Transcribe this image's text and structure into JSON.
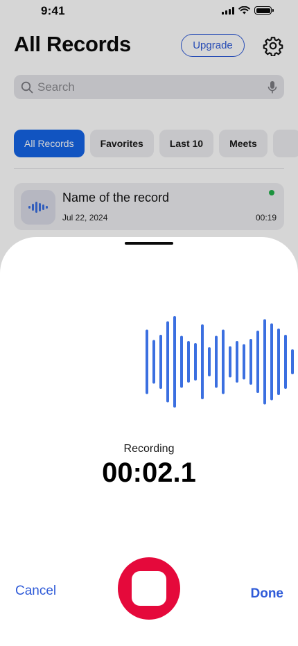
{
  "status_bar": {
    "time": "9:41"
  },
  "header": {
    "title": "All Records",
    "upgrade_label": "Upgrade",
    "settings_icon": "gear-icon"
  },
  "search": {
    "placeholder": "Search",
    "search_icon": "search-icon",
    "mic_icon": "microphone-icon"
  },
  "filters": {
    "items": [
      "All Records",
      "Favorites",
      "Last 10",
      "Meets"
    ],
    "active": "All Records"
  },
  "records": [
    {
      "name": "Name of the record",
      "date": "Jul 22, 2024",
      "duration": "00:19",
      "status_color": "#22b04b",
      "icon": "waveform-icon"
    }
  ],
  "recording_sheet": {
    "status_label": "Recording",
    "timer": "00:02.1",
    "cancel_label": "Cancel",
    "done_label": "Done",
    "stop_icon": "stop-icon",
    "waveform_levels": [
      0.62,
      0.42,
      0.52,
      0.78,
      0.88,
      0.5,
      0.4,
      0.36,
      0.72,
      0.28,
      0.5,
      0.62,
      0.3,
      0.4,
      0.34,
      0.44,
      0.6,
      0.82,
      0.74,
      0.64,
      0.52,
      0.24,
      0.26
    ]
  },
  "colors": {
    "accent": "#2f5bd8",
    "chip_active": "#1565e6",
    "stop": "#e5093b",
    "waveform": "#3b6fe0"
  }
}
